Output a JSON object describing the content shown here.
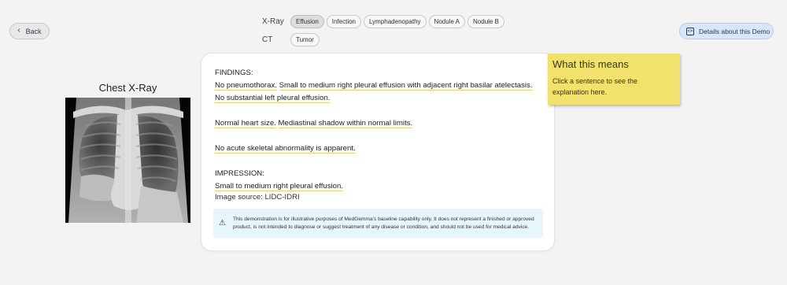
{
  "nav": {
    "back_label": "Back",
    "details_label": "Details about this Demo"
  },
  "modalities": {
    "xray": {
      "label": "X-Ray",
      "chips": [
        "Effusion",
        "Infection",
        "Lymphadenopathy",
        "Nodule A",
        "Nodule B"
      ],
      "selected": "Effusion"
    },
    "ct": {
      "label": "CT",
      "chips": [
        "Tumor"
      ]
    }
  },
  "image_panel": {
    "title": "Chest X-Ray"
  },
  "report": {
    "findings_header": "FINDINGS:",
    "s1": "No pneumothorax.",
    "s2": "Small to medium right pleural effusion with adjacent right basilar atelectasis.",
    "s3": "No substantial left pleural effusion.",
    "s4": "Normal heart size.",
    "s5": "Mediastinal shadow within normal limits.",
    "s6": "No acute skeletal abnormality is apparent.",
    "impression_header": "IMPRESSION:",
    "s7": "Small to medium right pleural effusion.",
    "source": "Image source: LIDC-IDRI",
    "disclaimer": "This demonstration is for illustrative purposes of MedGemma's baseline capability only. It does not represent a finished or approved product, is not intended to diagnose or suggest treatment of any disease or condition, and should not be used for medical advice."
  },
  "explanation": {
    "title": "What this means",
    "body": "Click a sentence to see the explanation here."
  },
  "colors": {
    "background": "#f3f3f4",
    "note_yellow": "#f1e26d",
    "details_blue": "#d8e6f5",
    "disclaimer_bg": "#e7f6fb",
    "sentence_underline": "#e8d36a"
  },
  "icons": {
    "back": "chevron-left-icon",
    "details": "code-icon",
    "disclaimer": "warning-icon"
  }
}
